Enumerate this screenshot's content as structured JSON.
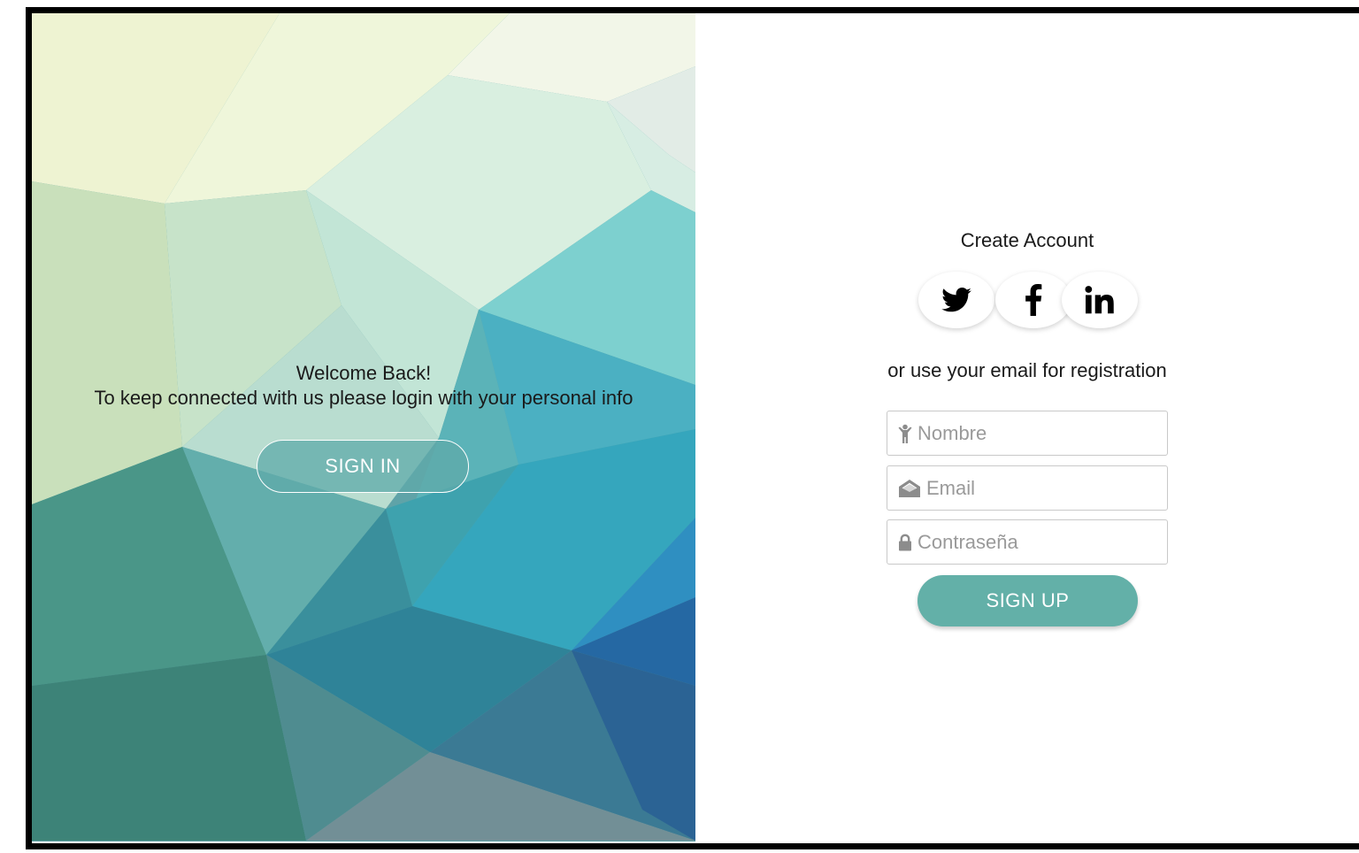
{
  "overlay": {
    "welcome_title": "Welcome Back!",
    "welcome_message": "To keep connected with us please login with your personal info",
    "signin_label": "SIGN IN"
  },
  "form": {
    "title": "Create Account",
    "socials": [
      {
        "icon": "twitter-icon"
      },
      {
        "icon": "facebook-icon"
      },
      {
        "icon": "linkedin-icon"
      }
    ],
    "or_text": "or use your email for registration",
    "fields": {
      "nombre_placeholder": "Nombre",
      "email_placeholder": "Email",
      "password_placeholder": "Contraseña"
    },
    "signup_label": "SIGN UP"
  },
  "colors": {
    "accent": "#63b0a8",
    "text": "#1a1a1a",
    "placeholder": "#9a9a9a"
  }
}
